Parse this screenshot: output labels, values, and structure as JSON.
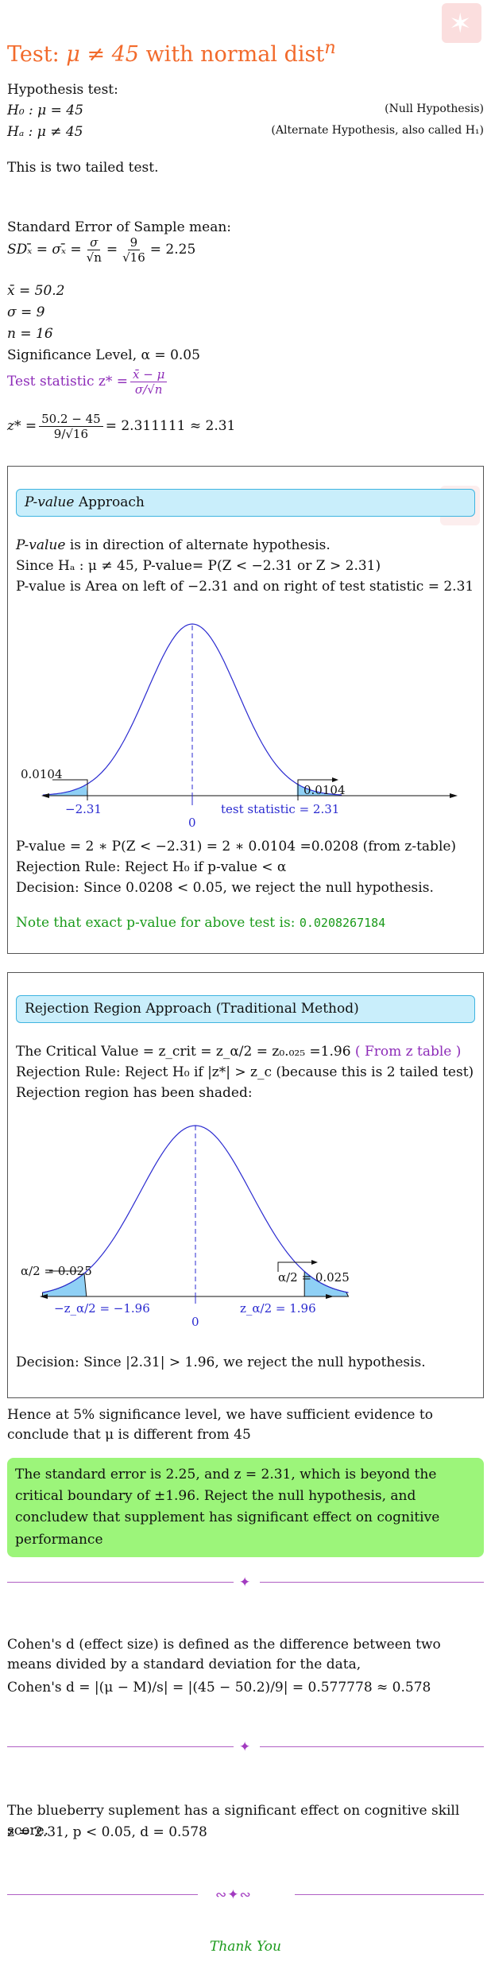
{
  "title": {
    "text": "Test: ",
    "mu_expr": "μ ≠ 45",
    "rest": " with normal dist",
    "sup": "n"
  },
  "hypotheses": {
    "heading": "Hypothesis test:",
    "h0": "H₀ : μ = 45",
    "h0_note": "(Null Hypothesis)",
    "ha": "Hₐ : μ ≠ 45",
    "ha_note": "(Alternate Hypothesis, also called H₁)"
  },
  "two_tailed": "This is two tailed test.",
  "se": {
    "heading": "Standard Error of Sample mean:",
    "lhs": "SDₓ̄ = σₓ̄ = ",
    "f1_num": "σ",
    "f1_den": "√n",
    "eq": " = ",
    "f2_num": "9",
    "f2_den": "√16",
    "result": " = 2.25"
  },
  "given": {
    "xbar": "x̄ = 50.2",
    "sigma": "σ = 9",
    "n": "n = 16",
    "alpha": "Significance Level, α = 0.05"
  },
  "test_stat": {
    "label": "Test statistic z* = ",
    "num": "x̄ − μ",
    "den": "σ/√n"
  },
  "z_calc": {
    "lhs": "z* = ",
    "num": "50.2 − 45",
    "den": "9/√16",
    "rhs": " = 2.311111 ≈ 2.31"
  },
  "pvalue_box": {
    "header_italic": "P-value",
    "header_rest": " Approach",
    "line1_italic": "P-value",
    "line1_rest": " is in direction of alternate hypothesis.",
    "line2": "Since Hₐ : μ ≠ 45, P-value= P(Z < −2.31 or Z > 2.31)",
    "line3": "P-value is Area on left of −2.31 and on right of test statistic = 2.31",
    "chart": {
      "left_area": "0.0104",
      "right_area": "0.0104",
      "left_tick": "−2.31",
      "right_tick": "test statistic = 2.31",
      "center_tick": "0"
    },
    "result1": "P-value = 2 ∗ P(Z < −2.31) = 2 ∗ 0.0104 =0.0208 (from z-table)",
    "result2": "Rejection Rule: Reject H₀ if p-value < α",
    "result3": "Decision: Since 0.0208 < 0.05, we reject the null hypothesis.",
    "note": "Note that exact p-value for above test is: ",
    "note_value": "0.0208267184"
  },
  "rr_box": {
    "header": "Rejection Region Approach (Traditional Method)",
    "line1": "The Critical Value = z_crit = z_α/2 = z₀.₀₂₅ =1.96",
    "line1_purple": " ( From z table )",
    "line2": "Rejection Rule: Reject H₀ if |z*| > z_c (because this is 2 tailed test)",
    "line3": "Rejection region has been shaded:",
    "chart": {
      "left_area": "α/2 = 0.025",
      "right_area": "α/2 = 0.025",
      "left_tick": "−z_α/2 = −1.96",
      "right_tick": "z_α/2 = 1.96",
      "center_tick": "0"
    },
    "decision": "Decision: Since |2.31| > 1.96, we reject the null hypothesis."
  },
  "conclusion": "Hence at 5% significance level, we have sufficient evidence to conclude that μ is different from 45",
  "highlight": "The standard error is 2.25, and z = 2.31, which is beyond the critical boundary of ±1.96. Reject the null hypothesis, and concludew that supplement has significant effect on cognitive performance",
  "cohen": {
    "line1": "Cohen's d (effect size) is defined as the difference between two means divided by a standard deviation for the data,",
    "line2": "Cohen's d = |(μ − M)/s| = |(45 − 50.2)/9| = 0.577778 ≈ 0.578"
  },
  "summary": {
    "line1": "The blueberry suplement has a significant effect on cognitive skill score.",
    "line2": "z = 2.31, p < 0.05, d = 0.578"
  },
  "thanks": "Thank You",
  "colors": {
    "title": "#f26a2b",
    "curve": "#2a2ad0",
    "shade": "#8fd0f5",
    "accent": "#8d2bb8",
    "green": "#1a9a1a",
    "highlight": "#9cf57a"
  }
}
